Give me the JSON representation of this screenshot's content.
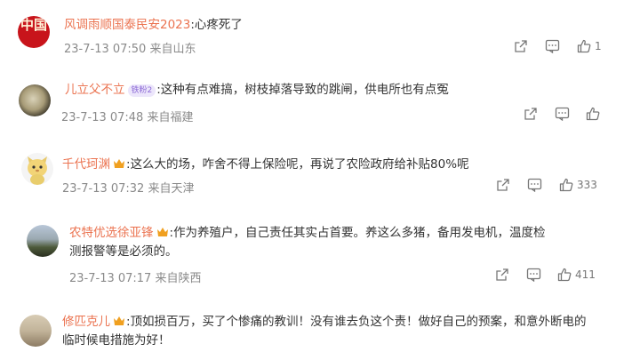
{
  "comments": [
    {
      "name": "风调雨顺国泰民安2023",
      "separator": ":",
      "text": "心疼死了",
      "time": "23-7-13 07:50",
      "location": "来自山东",
      "like_count": "1",
      "avatar_glyph": "中国"
    },
    {
      "name": "儿立父不立",
      "badge": "铁粉2",
      "separator": ":",
      "text": "这种有点难搞，树枝掉落导致的跳闸，供电所也有点冤",
      "time": "23-7-13 07:48",
      "location": "来自福建",
      "like_count": ""
    },
    {
      "name": "千代珂渊",
      "separator": ":",
      "text": "这么大的场，咋舍不得上保险呢，再说了农险政府给补贴80%呢",
      "time": "23-7-13 07:32",
      "location": "来自天津",
      "like_count": "333"
    },
    {
      "name": "农特优选徐亚锋",
      "separator": ":",
      "text": "作为养殖户，自己责任其实占首要。养这么多猪，备用发电机，温度检测报警等是必须的。",
      "time": "23-7-13 07:17",
      "location": "来自陕西",
      "like_count": "411"
    },
    {
      "name": "修匹克儿",
      "separator": ":",
      "text": "顶如损百万，买了个惨痛的教训！没有谁去负这个责！做好自己的预案，和意外断电的临时候电措施为好！",
      "time": "",
      "location": "",
      "like_count": ""
    }
  ],
  "colors": {
    "username": "#eb7350",
    "username_alt": "#5d7fb5",
    "meta": "#8a8a8a",
    "crown": "#f0a020"
  },
  "icons": [
    "share-icon",
    "comment-icon",
    "like-icon",
    "crown-icon"
  ]
}
